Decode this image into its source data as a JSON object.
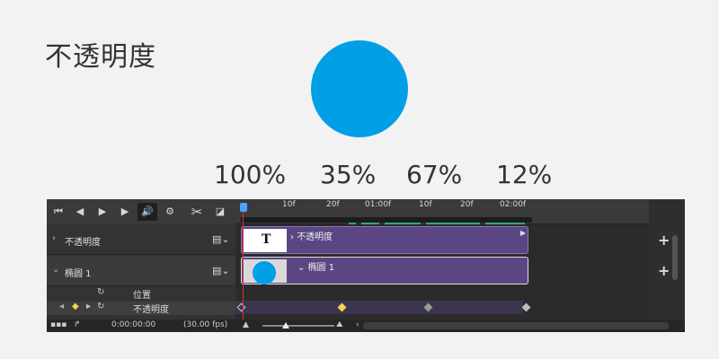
{
  "heading": "不透明度",
  "percentages": [
    "100%",
    "35%",
    "67%",
    "12%"
  ],
  "colors": {
    "circle": "#009fe6",
    "clip": "#5b4684",
    "keyframe_active": "#f2d64b",
    "keyframe_inactive": "#9a9a9a"
  },
  "controls": {
    "first_frame": "⏮",
    "prev_frame": "◀",
    "play": "▶",
    "next_frame": "▶",
    "audio": "🔊",
    "settings": "⚙",
    "split": "✂",
    "transition": "◪"
  },
  "ruler": [
    "10f",
    "20f",
    "01:00f",
    "10f",
    "20f",
    "02:00f"
  ],
  "layers": [
    {
      "name": "不透明度",
      "clip_label": "不透明度"
    },
    {
      "name": "椭圆 1",
      "clip_label": "椭圆 1"
    }
  ],
  "properties": {
    "position": "位置",
    "opacity": "不透明度"
  },
  "status": {
    "timecode": "0:00:00:00",
    "fps": "(30.00 fps)"
  },
  "icons": {
    "expand": "chevron-right-icon",
    "film": "film-icon",
    "stopwatch": "stopwatch-icon",
    "add": "plus-icon"
  }
}
